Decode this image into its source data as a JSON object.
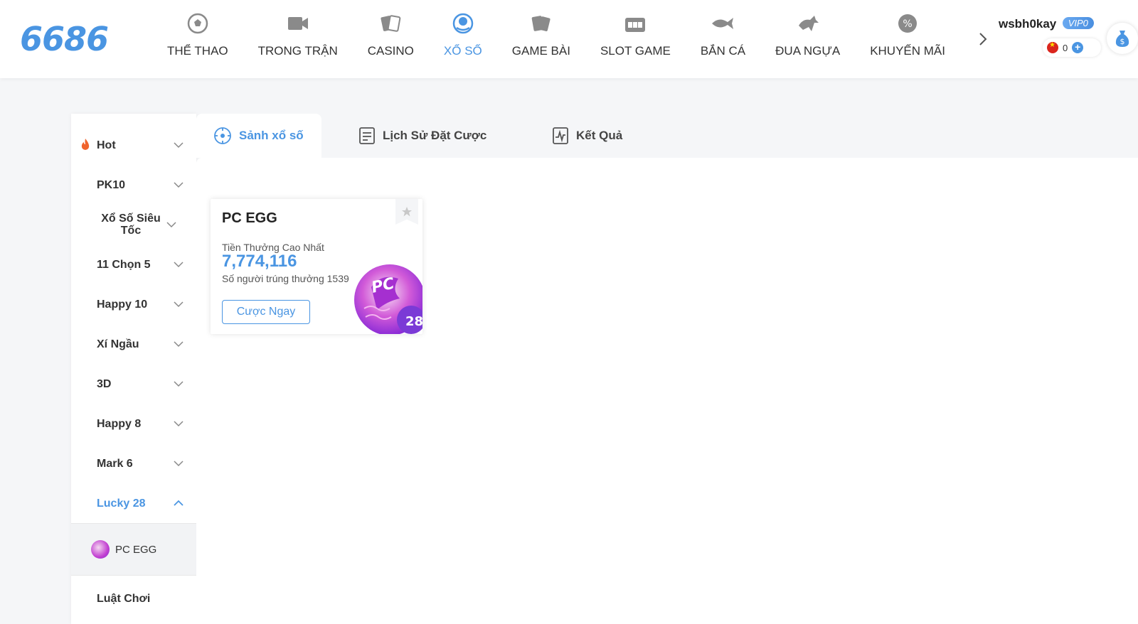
{
  "logo": "6686",
  "nav": {
    "items": [
      {
        "label": "THỂ THAO",
        "icon": "soccer-ball-icon",
        "active": false
      },
      {
        "label": "TRONG TRẬN",
        "icon": "video-camera-icon",
        "active": false
      },
      {
        "label": "CASINO",
        "icon": "cards-icon",
        "active": false
      },
      {
        "label": "XỔ SỐ",
        "icon": "lottery-ball-icon",
        "active": true
      },
      {
        "label": "GAME BÀI",
        "icon": "card-game-icon",
        "active": false
      },
      {
        "label": "SLOT GAME",
        "icon": "slot-machine-icon",
        "active": false
      },
      {
        "label": "BẮN CÁ",
        "icon": "fish-icon",
        "active": false
      },
      {
        "label": "ĐUA NGỰA",
        "icon": "horse-racing-icon",
        "active": false
      },
      {
        "label": "KHUYẾN MÃI",
        "icon": "discount-icon",
        "active": false
      }
    ]
  },
  "user": {
    "name": "wsbh0kay",
    "vip": "VIP0",
    "balance": "0"
  },
  "sidebar": {
    "items": [
      {
        "label": "Hot"
      },
      {
        "label": "PK10"
      },
      {
        "label": "Xổ Số Siêu Tốc"
      },
      {
        "label": "11 Chọn 5"
      },
      {
        "label": "Happy 10"
      },
      {
        "label": "Xí Ngầu"
      },
      {
        "label": "3D"
      },
      {
        "label": "Happy 8"
      },
      {
        "label": "Mark 6"
      },
      {
        "label": "Lucky 28"
      }
    ],
    "sub_item": "PC EGG",
    "rules": "Luật Chơi"
  },
  "tabs": [
    {
      "label": "Sảnh xổ số"
    },
    {
      "label": "Lịch Sử Đặt Cược"
    },
    {
      "label": "Kết Quả"
    }
  ],
  "card": {
    "title": "PC EGG",
    "prize_label": "Tiền Thưởng Cao Nhất",
    "prize": "7,774,116",
    "winners": "Số người trúng thưởng 1539",
    "button": "Cược Ngay",
    "badge_text": "PC",
    "badge_num": "28"
  },
  "colors": {
    "accent": "#4a95e2",
    "text": "#333333"
  }
}
